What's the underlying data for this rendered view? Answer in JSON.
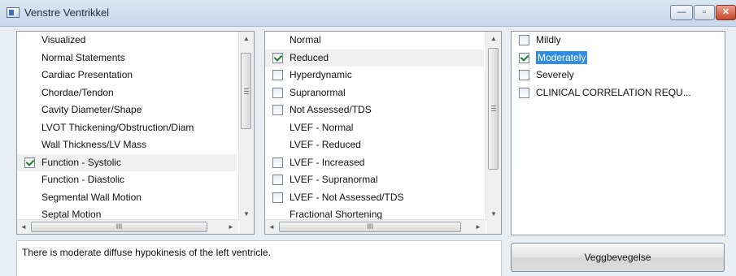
{
  "window": {
    "title": "Venstre Ventrikkel",
    "controls": {
      "minimize": "—",
      "maximize": "▫",
      "close": "✕"
    }
  },
  "panel1": {
    "items": [
      {
        "label": "Visualized",
        "checkbox": false
      },
      {
        "label": "Normal Statements",
        "checkbox": false
      },
      {
        "label": "Cardiac Presentation",
        "checkbox": false
      },
      {
        "label": "Chordae/Tendon",
        "checkbox": false
      },
      {
        "label": "Cavity Diameter/Shape",
        "checkbox": false
      },
      {
        "label": "LVOT Thickening/Obstruction/Diam",
        "checkbox": false
      },
      {
        "label": "Wall Thickness/LV Mass",
        "checkbox": false
      },
      {
        "label": "Function - Systolic",
        "checkbox": true,
        "checked": true,
        "selected": true
      },
      {
        "label": "Function - Diastolic",
        "checkbox": false
      },
      {
        "label": "Segmental Wall Motion",
        "checkbox": false
      },
      {
        "label": "Septal Motion",
        "checkbox": false
      }
    ],
    "scroll": {
      "up": "▲",
      "down": "▼",
      "left": "◄",
      "right": "►",
      "thumb": "III"
    }
  },
  "panel2": {
    "items": [
      {
        "label": "Normal",
        "checkbox": false
      },
      {
        "label": "Reduced",
        "checkbox": true,
        "checked": true,
        "selected": true
      },
      {
        "label": "Hyperdynamic",
        "checkbox": true,
        "checked": false
      },
      {
        "label": "Supranormal",
        "checkbox": true,
        "checked": false
      },
      {
        "label": "Not Assessed/TDS",
        "checkbox": true,
        "checked": false
      },
      {
        "label": "LVEF - Normal",
        "checkbox": false
      },
      {
        "label": "LVEF - Reduced",
        "checkbox": false
      },
      {
        "label": "LVEF - Increased",
        "checkbox": true,
        "checked": false
      },
      {
        "label": "LVEF - Supranormal",
        "checkbox": true,
        "checked": false
      },
      {
        "label": "LVEF - Not Assessed/TDS",
        "checkbox": true,
        "checked": false
      },
      {
        "label": "Fractional Shortening",
        "checkbox": false
      }
    ],
    "scroll": {
      "up": "▲",
      "down": "▼",
      "left": "◄",
      "right": "►",
      "thumb": "III"
    }
  },
  "panel3": {
    "items": [
      {
        "label": "Mildly",
        "checkbox": true,
        "checked": false
      },
      {
        "label": "Moderately",
        "checkbox": true,
        "checked": true,
        "highlighted": true
      },
      {
        "label": "Severely",
        "checkbox": true,
        "checked": false
      },
      {
        "label": "CLINICAL CORRELATION REQU...",
        "checkbox": true,
        "checked": false
      }
    ]
  },
  "text_output": "There is moderate diffuse hypokinesis of the left ventricle.",
  "action_button": "Veggbevegelse"
}
